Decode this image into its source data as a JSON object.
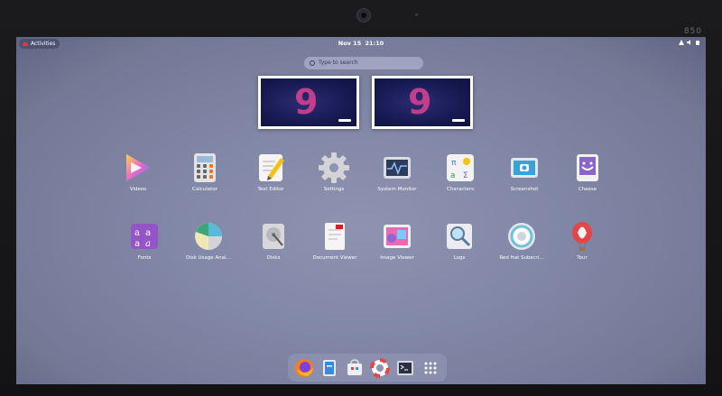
{
  "bezel": {
    "model_label": "850"
  },
  "topbar": {
    "activities_label": "Activities",
    "date": "Nov 15",
    "time": "21:10"
  },
  "search": {
    "placeholder": "Type to search"
  },
  "workspaces": [
    {
      "wallpaper_text": "9"
    },
    {
      "wallpaper_text": "9"
    }
  ],
  "apps": [
    {
      "label": "Videos",
      "icon": "videos-icon"
    },
    {
      "label": "Calculator",
      "icon": "calculator-icon"
    },
    {
      "label": "Text Editor",
      "icon": "text-editor-icon"
    },
    {
      "label": "Settings",
      "icon": "settings-gear-icon"
    },
    {
      "label": "System Monitor",
      "icon": "system-monitor-icon"
    },
    {
      "label": "Characters",
      "icon": "characters-icon"
    },
    {
      "label": "Screenshot",
      "icon": "screenshot-icon"
    },
    {
      "label": "Cheese",
      "icon": "cheese-icon"
    },
    {
      "label": "Fonts",
      "icon": "fonts-icon"
    },
    {
      "label": "Disk Usage Anal…",
      "icon": "disk-usage-analyzer-icon"
    },
    {
      "label": "Disks",
      "icon": "disks-icon"
    },
    {
      "label": "Document Viewer",
      "icon": "document-viewer-icon"
    },
    {
      "label": "Image Viewer",
      "icon": "image-viewer-icon"
    },
    {
      "label": "Logs",
      "icon": "logs-icon"
    },
    {
      "label": "Red Hat Subscri…",
      "icon": "red-hat-subscription-icon"
    },
    {
      "label": "Tour",
      "icon": "tour-balloon-icon"
    }
  ],
  "dock": [
    {
      "icon": "firefox-icon"
    },
    {
      "icon": "files-icon"
    },
    {
      "icon": "software-icon"
    },
    {
      "icon": "help-icon"
    },
    {
      "icon": "terminal-icon"
    },
    {
      "icon": "show-apps-icon"
    }
  ]
}
